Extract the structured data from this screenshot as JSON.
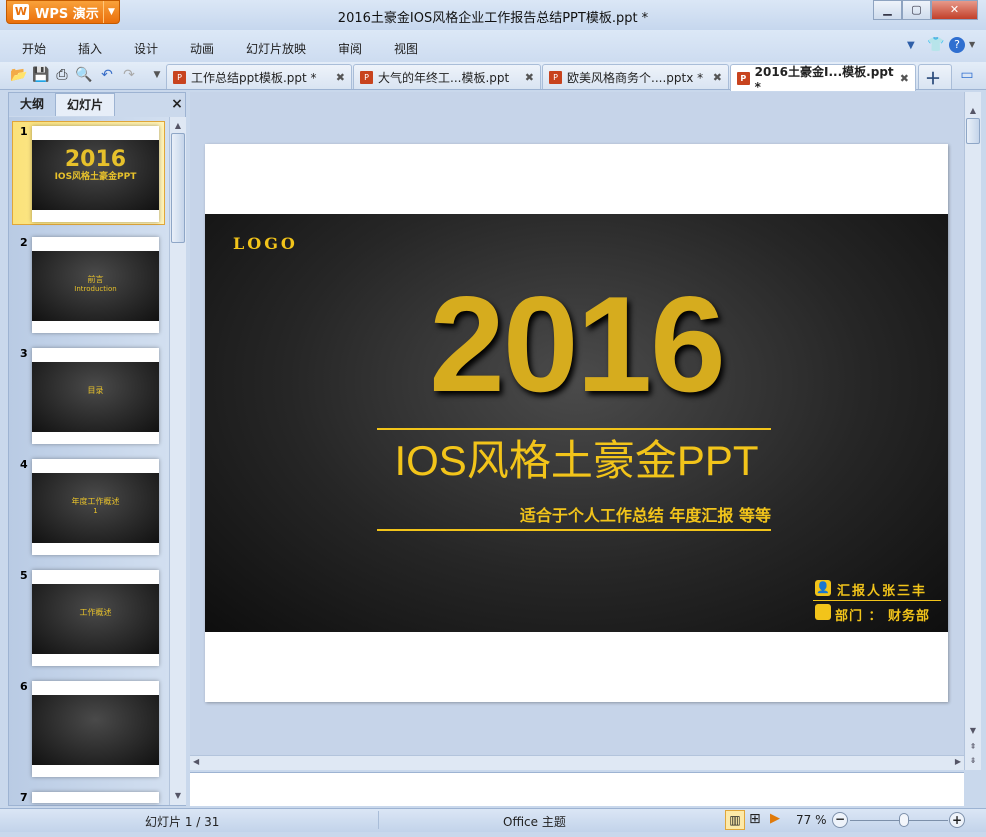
{
  "app": {
    "name": "WPS 演示",
    "title": "2016土豪金IOS风格企业工作报告总结PPT模板.ppt *"
  },
  "menu": [
    "开始",
    "插入",
    "设计",
    "动画",
    "幻灯片放映",
    "审阅",
    "视图"
  ],
  "tabs": [
    {
      "label": "工作总结ppt模板.ppt *",
      "active": false
    },
    {
      "label": "大气的年终工...模板.ppt",
      "active": false
    },
    {
      "label": "欧美风格商务个....pptx *",
      "active": false
    },
    {
      "label": "2016土豪金I...模板.ppt *",
      "active": true
    }
  ],
  "panel": {
    "tabs": [
      "大纲",
      "幻灯片"
    ],
    "active_tab": "幻灯片",
    "close": "×"
  },
  "thumbnails": [
    {
      "num": "1",
      "text": "2016",
      "sub": "IOS风格土豪金PPT",
      "selected": true
    },
    {
      "num": "2",
      "text": "前言",
      "sub": "Introduction"
    },
    {
      "num": "3",
      "text": "目录",
      "sub": ""
    },
    {
      "num": "4",
      "text": "年度工作概述",
      "sub": "1"
    },
    {
      "num": "5",
      "text": "工作概述",
      "sub": ""
    },
    {
      "num": "6",
      "text": "",
      "sub": ""
    },
    {
      "num": "7",
      "text": "",
      "sub": ""
    }
  ],
  "slide": {
    "logo": "LOGO",
    "year": "2016",
    "title": "IOS风格土豪金PPT",
    "subtitle": "适合于个人工作总结 年度汇报 等等",
    "reporter": "汇报人张三丰",
    "department": "部门 ： 财务部"
  },
  "status": {
    "slide": "幻灯片 1 / 31",
    "theme": "Office 主题",
    "zoom": "77 %",
    "zoom_value": 77
  },
  "colors": {
    "gold": "#f2c41a",
    "accent": "#ea6f0b"
  }
}
